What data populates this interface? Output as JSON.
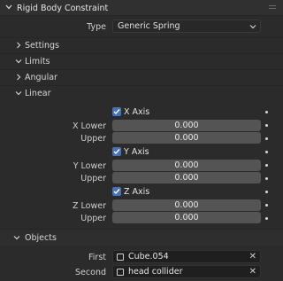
{
  "panel": {
    "title": "Rigid Body Constraint"
  },
  "type_row": {
    "label": "Type",
    "value": "Generic Spring"
  },
  "sections": {
    "settings": "Settings",
    "limits": "Limits",
    "angular": "Angular",
    "linear": "Linear",
    "objects": "Objects"
  },
  "linear": {
    "x_axis": {
      "label": "X Axis",
      "checked": true,
      "lower_label": "X Lower",
      "lower": "0.000",
      "upper_label": "Upper",
      "upper": "0.000"
    },
    "y_axis": {
      "label": "Y Axis",
      "checked": true,
      "lower_label": "Y Lower",
      "lower": "0.000",
      "upper_label": "Upper",
      "upper": "0.000"
    },
    "z_axis": {
      "label": "Z Axis",
      "checked": true,
      "lower_label": "Z Lower",
      "lower": "0.000",
      "upper_label": "Upper",
      "upper": "0.000"
    }
  },
  "objects": {
    "first_label": "First",
    "first_value": "Cube.054",
    "second_label": "Second",
    "second_value": "head collider"
  },
  "colors": {
    "accent": "#4772b3",
    "field": "#545454",
    "bg": "#2b2b2b"
  }
}
